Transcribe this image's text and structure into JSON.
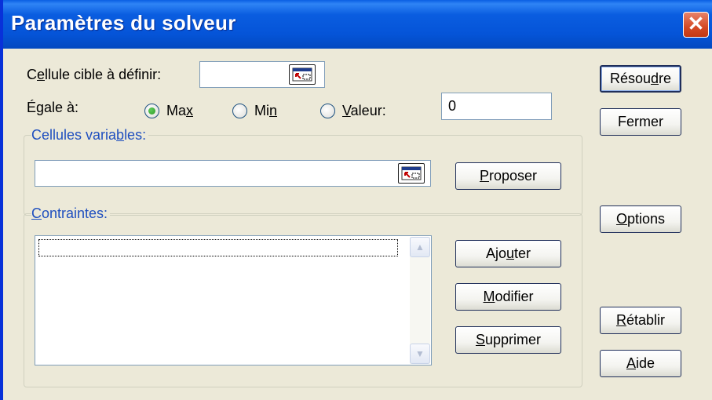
{
  "window": {
    "title": "Paramètres du solveur",
    "close_glyph": "✕"
  },
  "target_cell": {
    "label_pre": "C",
    "label_acc": "e",
    "label_post": "llule cible à définir:",
    "value": ""
  },
  "equal_to": {
    "label": "Égale à:",
    "options": [
      {
        "pre": "Ma",
        "acc": "x",
        "post": "",
        "checked": true
      },
      {
        "pre": "Mi",
        "acc": "n",
        "post": "",
        "checked": false
      },
      {
        "pre": "",
        "acc": "V",
        "post": "aleur:",
        "checked": false
      }
    ],
    "value_input": "0"
  },
  "variable_cells": {
    "legend_pre": "Cellules varia",
    "legend_acc": "b",
    "legend_post": "les:",
    "value": ""
  },
  "constraints": {
    "legend_pre": "",
    "legend_acc": "C",
    "legend_post": "ontraintes:",
    "items": []
  },
  "buttons": {
    "solve": {
      "pre": "Résou",
      "acc": "d",
      "post": "re"
    },
    "close": {
      "pre": "Fermer",
      "acc": "",
      "post": ""
    },
    "guess": {
      "pre": "",
      "acc": "P",
      "post": "roposer"
    },
    "options": {
      "pre": "",
      "acc": "O",
      "post": "ptions"
    },
    "add": {
      "pre": "Ajo",
      "acc": "u",
      "post": "ter"
    },
    "change": {
      "pre": "",
      "acc": "M",
      "post": "odifier"
    },
    "delete": {
      "pre": "",
      "acc": "S",
      "post": "upprimer"
    },
    "reset": {
      "pre": "",
      "acc": "R",
      "post": "établir"
    },
    "help": {
      "pre": "",
      "acc": "A",
      "post": "ide"
    }
  },
  "colors": {
    "titlebar": "#0554d8",
    "accent_text": "#1f4fbf",
    "close_button": "#d54a25",
    "dialog_bg": "#ece9d8"
  },
  "icons": {
    "close": "close-icon",
    "range_ref": "collapse-dialog-icon",
    "scroll_up": "scroll-up-arrow-icon",
    "scroll_down": "scroll-down-arrow-icon"
  }
}
